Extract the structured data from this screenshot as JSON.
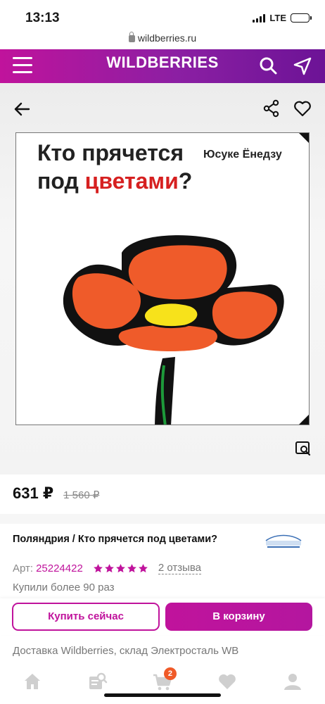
{
  "status_bar": {
    "time": "13:13",
    "network": "LTE"
  },
  "browser": {
    "url": "wildberries.ru"
  },
  "header": {
    "logo": "WILDBERRIES"
  },
  "product": {
    "cover": {
      "title_line1": "Кто прячется",
      "title_line2_a": "под ",
      "title_line2_b": "цветами",
      "title_line2_c": "?",
      "author": "Юсуке Ёнедзу"
    },
    "price": "631 ₽",
    "old_price": "1 560 ₽",
    "title": "Поляндрия / Кто прячется под цветами?",
    "article_label": "Арт:",
    "article_number": "25224422",
    "rating": 5,
    "reviews": "2 отзыва",
    "bought": "Купили более 90 раз",
    "delivery": "Доставка Wildberries, склад Электросталь WB"
  },
  "actions": {
    "buy_now": "Купить сейчас",
    "add_to_cart": "В корзину"
  },
  "tabbar": {
    "items": [
      {
        "icon": "home-icon"
      },
      {
        "icon": "catalog-search-icon"
      },
      {
        "icon": "cart-icon",
        "badge": "2"
      },
      {
        "icon": "heart-icon"
      },
      {
        "icon": "profile-icon"
      }
    ]
  },
  "colors": {
    "brand": "#c0139c",
    "brand_dark": "#6c1396",
    "badge": "#f05a28"
  }
}
